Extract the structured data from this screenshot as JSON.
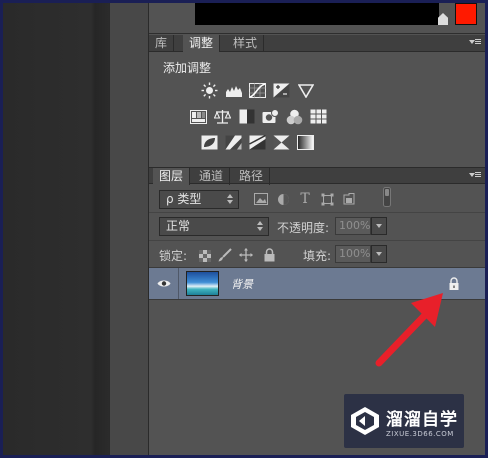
{
  "top_tabs": [
    {
      "label": "库",
      "active": false
    },
    {
      "label": "调整",
      "active": true
    },
    {
      "label": "样式",
      "active": false
    }
  ],
  "adjustments": {
    "title": "添加调整",
    "row1": [
      "brightness-icon",
      "levels-icon",
      "curves-icon",
      "exposure-icon",
      "vibrance-icon"
    ],
    "row2": [
      "hue-saturation-icon",
      "color-balance-icon",
      "black-white-icon",
      "photo-filter-icon",
      "channel-mixer-icon",
      "color-lookup-icon"
    ],
    "row3": [
      "invert-icon",
      "posterize-icon",
      "threshold-icon",
      "selective-color-icon",
      "gradient-map-icon"
    ]
  },
  "layer_tabs": [
    {
      "label": "图层",
      "active": true
    },
    {
      "label": "通道",
      "active": false
    },
    {
      "label": "路径",
      "active": false
    }
  ],
  "filter": {
    "kind_label": "ρ 类型"
  },
  "blend": {
    "mode": "正常",
    "opacity_label": "不透明度:",
    "opacity_value": "100%"
  },
  "lock": {
    "label": "锁定:",
    "fill_label": "填充:",
    "fill_value": "100%"
  },
  "layer": {
    "name": "背景"
  },
  "watermark": {
    "title": "溜溜自学",
    "subtitle": "ZIXUE.3D66.COM"
  },
  "colors": {
    "accent_red": "#ff1a00",
    "selected_layer": "#6c7a92",
    "panel_bg": "#535353",
    "arrow_red": "#e8202a"
  }
}
